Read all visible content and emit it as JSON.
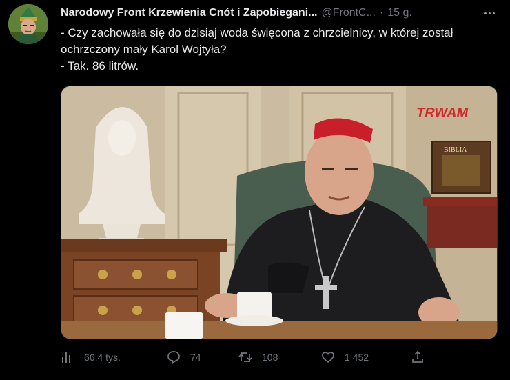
{
  "tweet": {
    "author_name": "Narodowy Front Krzewienia Cnót i Zapobiegani...",
    "handle": "@FrontC...",
    "separator": "·",
    "time": "15 g.",
    "lines": [
      "- Czy zachowała się do dzisiaj woda święcona z chrzcielnicy, w której został ochrzczony mały Karol Wojtyła?",
      "- Tak. 86 litrów."
    ],
    "media": {
      "watermark": "TRWAM",
      "book_label": "BIBLIA"
    }
  },
  "actions": {
    "views": "66,4 tys.",
    "replies": "74",
    "retweets": "108",
    "likes": "1 452"
  },
  "icons": {
    "views": "bar-chart-icon",
    "reply": "reply-icon",
    "retweet": "retweet-icon",
    "like": "heart-icon",
    "share": "share-icon",
    "more": "more-icon"
  },
  "colors": {
    "background": "#000000",
    "text": "#e7e9ea",
    "muted": "#71767b"
  }
}
